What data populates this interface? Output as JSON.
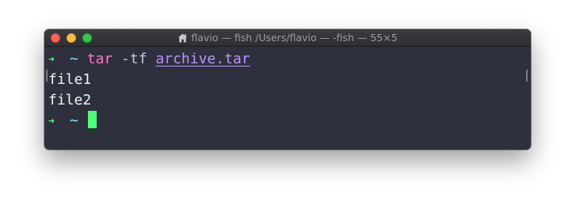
{
  "window": {
    "title": "flavio — fish /Users/flavio — -fish — 55×5",
    "home_icon": "home-icon"
  },
  "terminal": {
    "prompt_arrow": "➜",
    "prompt_dir": "~",
    "command": {
      "program": "tar",
      "flags": "-tf",
      "argument": "archive.tar"
    },
    "output": [
      "file1",
      "file2"
    ]
  },
  "colors": {
    "background": "#2e303d",
    "arrow": "#50fa7b",
    "tilde": "#8be9fd",
    "command": "#ff79c6",
    "argument": "#bd93f9",
    "cursor": "#50fa7b"
  }
}
